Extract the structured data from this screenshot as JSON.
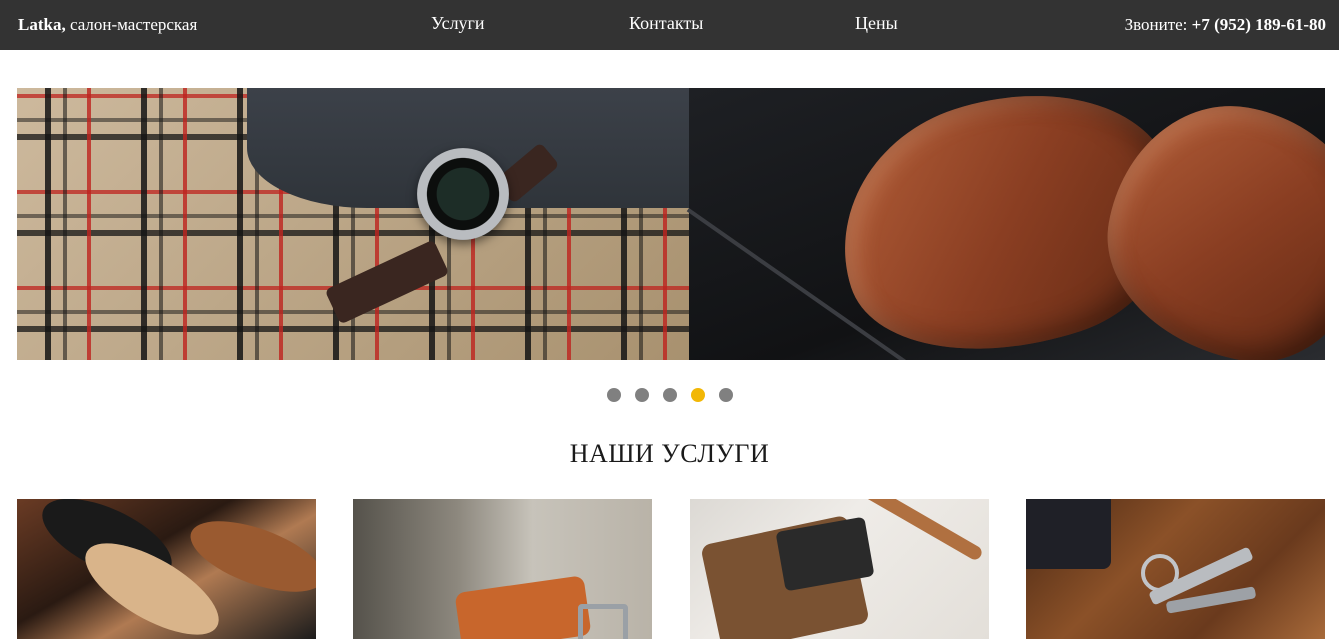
{
  "header": {
    "brand_name": "Latka,",
    "brand_tagline": " салон-мастерская",
    "nav": [
      {
        "label": "Услуги"
      },
      {
        "label": "Контакты"
      },
      {
        "label": "Цены"
      }
    ],
    "phone_prefix": "Звоните: ",
    "phone_number": "+7 (952) 189-61-80"
  },
  "slider": {
    "dots_count": 5,
    "active_dot_index": 3
  },
  "services": {
    "title": "НАШИ УСЛУГИ"
  },
  "colors": {
    "topbar_bg": "#333333",
    "dot_inactive": "#808080",
    "dot_active": "#f2b705"
  }
}
